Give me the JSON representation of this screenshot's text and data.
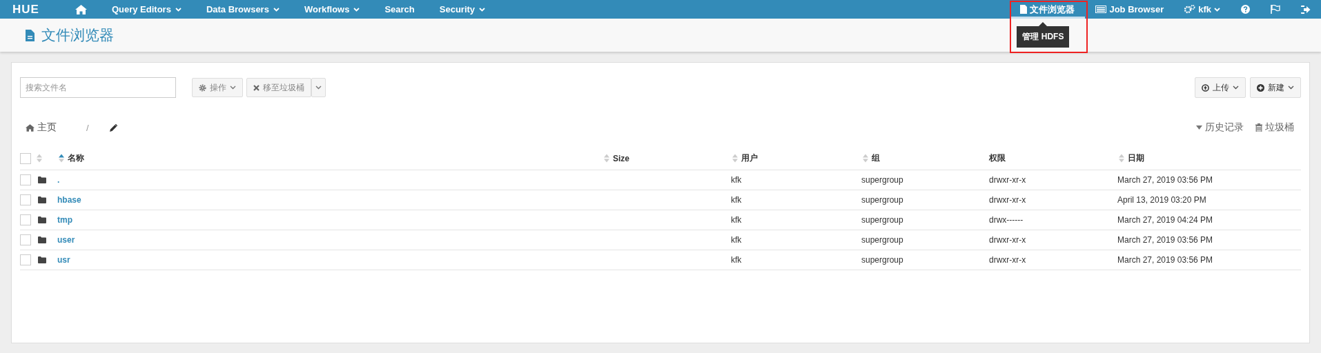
{
  "navbar": {
    "logo": "HUE",
    "left": [
      {
        "kind": "home"
      },
      {
        "kind": "text",
        "label": "Query Editors",
        "dropdown": true
      },
      {
        "kind": "text",
        "label": "Data Browsers",
        "dropdown": true
      },
      {
        "kind": "text",
        "label": "Workflows",
        "dropdown": true
      },
      {
        "kind": "text",
        "label": "Search",
        "dropdown": false
      },
      {
        "kind": "text",
        "label": "Security",
        "dropdown": true
      }
    ],
    "right": [
      {
        "kind": "file",
        "label": "文件浏览器",
        "dropdown": false,
        "selected": true,
        "highlighted": true,
        "tooltip": "管理 HDFS"
      },
      {
        "kind": "jobs",
        "label": "Job Browser",
        "dropdown": false,
        "selected": false,
        "highlighted": false
      },
      {
        "kind": "user",
        "label": "kfk",
        "dropdown": true,
        "selected": false,
        "highlighted": false
      },
      {
        "kind": "help",
        "dropdown": false,
        "selected": false,
        "highlighted": false
      },
      {
        "kind": "flag",
        "dropdown": false,
        "selected": false,
        "highlighted": false
      },
      {
        "kind": "logout",
        "dropdown": false,
        "selected": false,
        "highlighted": false
      }
    ]
  },
  "page_title": "文件浏览器",
  "toolbar": {
    "search": {
      "placeholder": "搜索文件名"
    },
    "actions": [
      {
        "kind": "gear",
        "label": "操作",
        "split": false
      },
      {
        "kind": "times",
        "label": "移至垃圾桶",
        "split": true
      }
    ],
    "right": [
      {
        "kind": "upload",
        "label": "上传"
      },
      {
        "kind": "plus",
        "label": "新建"
      }
    ]
  },
  "breadcrumb": {
    "home": "主页",
    "separator": "/"
  },
  "links": [
    {
      "kind": "caret",
      "label": "历史记录"
    },
    {
      "kind": "trash",
      "label": "垃圾桶"
    }
  ],
  "table": {
    "header_checked": false,
    "columns": [
      {
        "sortable": true,
        "sorted": false
      },
      {
        "label": "名称",
        "sortable": true,
        "sorted": true
      },
      {
        "label": "Size",
        "sortable": true,
        "sorted": false
      },
      {
        "label": "用户",
        "sortable": true,
        "sorted": false
      },
      {
        "label": "组",
        "sortable": true,
        "sorted": false
      },
      {
        "label": "权限",
        "sortable": false
      },
      {
        "label": "日期",
        "sortable": true,
        "sorted": false
      }
    ],
    "rows": [
      {
        "checked": false,
        "kind": "folder",
        "name": ".",
        "user": "kfk",
        "group": "supergroup",
        "permissions": "drwxr-xr-x",
        "date": "March 27, 2019 03:56 PM"
      },
      {
        "checked": false,
        "kind": "folder",
        "name": "hbase",
        "user": "kfk",
        "group": "supergroup",
        "permissions": "drwxr-xr-x",
        "date": "April 13, 2019 03:20 PM"
      },
      {
        "checked": false,
        "kind": "folder",
        "name": "tmp",
        "user": "kfk",
        "group": "supergroup",
        "permissions": "drwx------",
        "date": "March 27, 2019 04:24 PM"
      },
      {
        "checked": false,
        "kind": "folder",
        "name": "user",
        "user": "kfk",
        "group": "supergroup",
        "permissions": "drwxr-xr-x",
        "date": "March 27, 2019 03:56 PM"
      },
      {
        "checked": false,
        "kind": "folder",
        "name": "usr",
        "user": "kfk",
        "group": "supergroup",
        "permissions": "drwxr-xr-x",
        "date": "March 27, 2019 03:56 PM"
      }
    ]
  }
}
